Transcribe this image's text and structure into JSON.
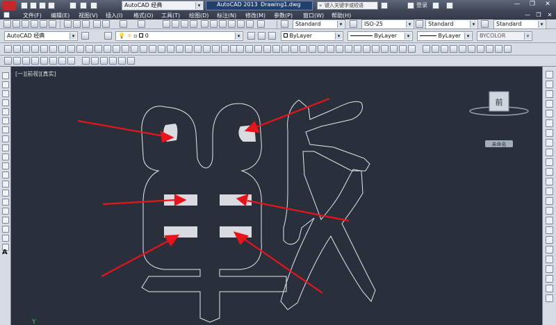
{
  "window": {
    "workspace_label": "AutoCAD 经典",
    "app_title": "AutoCAD 2013",
    "document_title": "Drawing1.dwg",
    "search_placeholder": "键入关键字或短语",
    "login_label": "登录"
  },
  "menu": {
    "items": [
      "文件(F)",
      "编辑(E)",
      "视图(V)",
      "插入(I)",
      "格式(O)",
      "工具(T)",
      "绘图(D)",
      "标注(N)",
      "修改(M)",
      "参数(P)",
      "窗口(W)",
      "帮助(H)"
    ]
  },
  "styles": {
    "text_style": "Standard",
    "dim_style": "ISO-25",
    "table_style": "Standard",
    "multileader_style": "Standard"
  },
  "layers": {
    "workspace": "AutoCAD 经典",
    "current_layer": "0",
    "color": "ByLayer",
    "linetype": "ByLayer",
    "lineweight": "ByLayer",
    "plot_style": "BYCOLOR"
  },
  "viewport": {
    "label": "[一][前视][真实]",
    "viewcube_face": "前",
    "wcs_label": "未命名"
  },
  "colors": {
    "canvas_background": "#29303b",
    "outline": "#e6e9ee",
    "filled_regions": "#d9dbe0",
    "arrows": "#e8141b",
    "ui_chrome": "#d7dce4"
  },
  "annotation": {
    "arrow_count": 6
  }
}
